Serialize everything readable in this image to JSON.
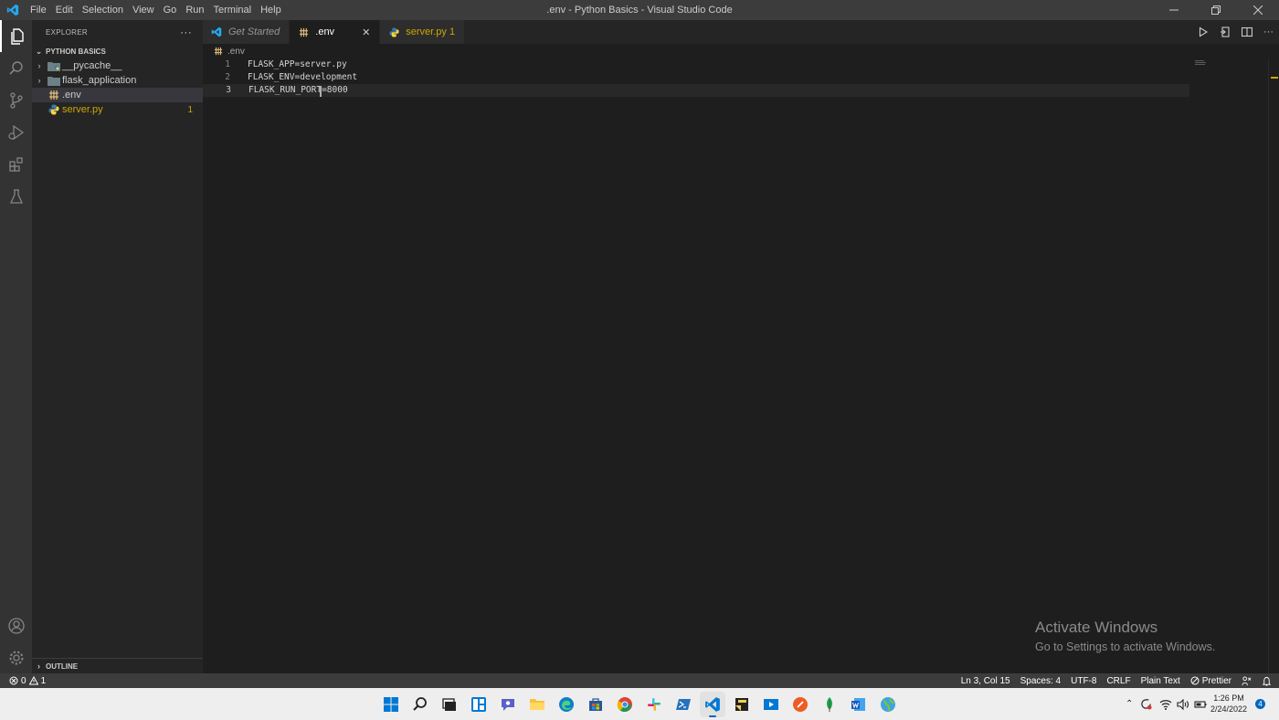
{
  "window": {
    "title": ".env - Python Basics - Visual Studio Code",
    "menu": [
      "File",
      "Edit",
      "Selection",
      "View",
      "Go",
      "Run",
      "Terminal",
      "Help"
    ]
  },
  "explorer": {
    "header": "EXPLORER",
    "more": "···",
    "folder": "PYTHON BASICS",
    "items": [
      {
        "label": "__pycache__",
        "type": "folder",
        "icon": "pycache-folder-icon"
      },
      {
        "label": "flask_application",
        "type": "folder",
        "icon": "folder-icon"
      },
      {
        "label": ".env",
        "type": "file",
        "icon": "env-file-icon",
        "selected": true
      },
      {
        "label": "server.py",
        "type": "file",
        "icon": "python-file-icon",
        "badge": "1",
        "modified": true
      }
    ],
    "outline": "OUTLINE"
  },
  "tabs": [
    {
      "label": "Get Started",
      "icon": "vscode-icon",
      "italic": true
    },
    {
      "label": ".env",
      "icon": "env-file-icon",
      "active": true,
      "close": "✕"
    },
    {
      "label": "server.py 1",
      "icon": "python-file-icon",
      "modified": true
    }
  ],
  "breadcrumb": ".env",
  "editor": {
    "lines": [
      {
        "num": "1",
        "text": "FLASK_APP=server.py"
      },
      {
        "num": "2",
        "text": "FLASK_ENV=development"
      },
      {
        "num": "3",
        "text": "FLASK_RUN_PORT=8000"
      }
    ],
    "cursor_line": 3,
    "cursor_col": 15
  },
  "watermark": {
    "title": "Activate Windows",
    "subtitle": "Go to Settings to activate Windows."
  },
  "statusbar": {
    "errors": "0",
    "warnings": "1",
    "position": "Ln 3, Col 15",
    "spaces": "Spaces: 4",
    "encoding": "UTF-8",
    "eol": "CRLF",
    "language": "Plain Text",
    "formatter": "Prettier"
  },
  "taskbar": {
    "time": "1:26 PM",
    "date": "2/24/2022",
    "notifications": "4"
  },
  "colors": {
    "accent": "#007acc",
    "modified": "#cca700",
    "taskbar_accent": "#0067c0"
  }
}
